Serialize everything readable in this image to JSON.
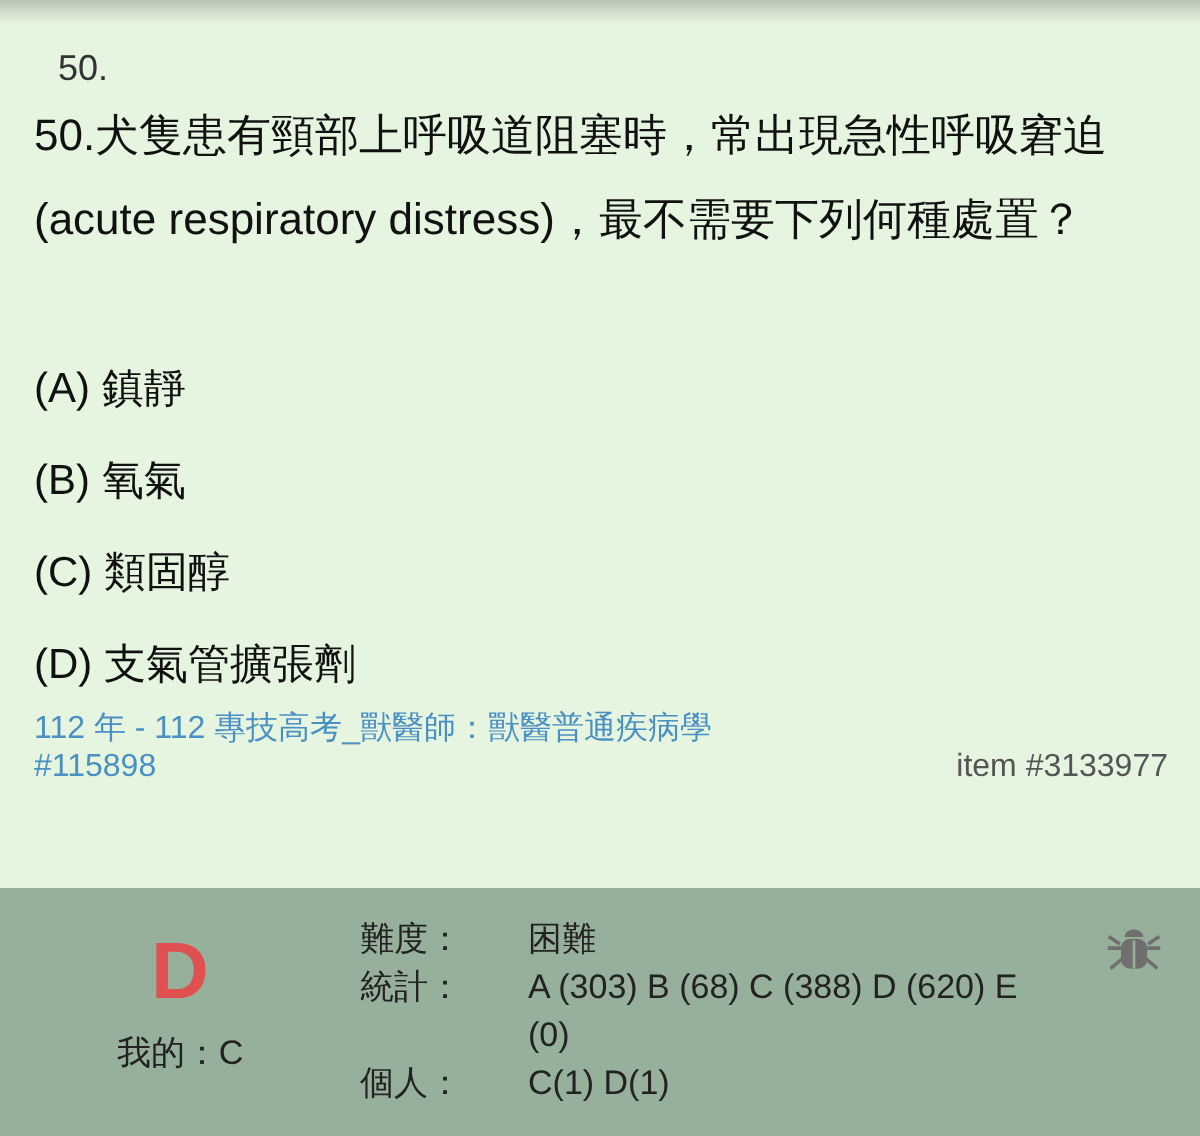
{
  "question_number": "50.",
  "question": "50.犬隻患有頸部上呼吸道阻塞時，常出現急性呼吸窘迫 (acute respiratory distress)，最不需要下列何種處置？",
  "options": [
    "(A) 鎮靜",
    "(B) 氧氣",
    "(C) 類固醇",
    "(D) 支氣管擴張劑"
  ],
  "source": "112 年 - 112 專技高考_獸醫師：獸醫普通疾病學",
  "exam_id": "#115898",
  "item_id": "item #3133977",
  "answer": {
    "correct": "D",
    "mine": "我的：C"
  },
  "stats": [
    {
      "label": "難度：",
      "value": "困難"
    },
    {
      "label": "統計：",
      "value": "A (303) B (68) C (388) D (620) E (0)"
    },
    {
      "label": "個人：",
      "value": "C(1) D(1)"
    }
  ]
}
